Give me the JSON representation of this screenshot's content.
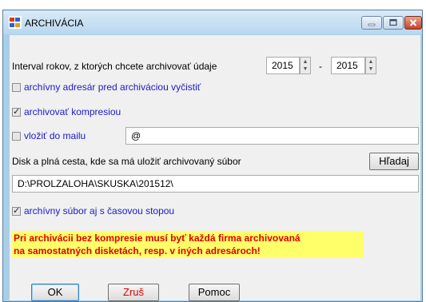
{
  "window": {
    "title": "ARCHIVÁCIA",
    "icons": [
      "app-icon",
      "minimize-icon",
      "maximize-icon",
      "close-icon"
    ]
  },
  "interval": {
    "label": "Interval rokov, z ktorých chcete archivovať údaje",
    "from": "2015",
    "separator": "-",
    "to": "2015"
  },
  "options": {
    "clear_dir": {
      "label": "archívny adresár pred archiváciou vyčistiť",
      "checked": false
    },
    "compress": {
      "label": "archivovať kompresiou",
      "checked": true
    },
    "mail": {
      "label": "vložiť do mailu",
      "checked": false,
      "value": "@"
    },
    "timestamp": {
      "label": "archívny súbor aj s časovou stopou",
      "checked": true
    }
  },
  "path": {
    "label": "Disk a plná cesta, kde sa má uložiť archivovaný súbor",
    "browse_label": "Hľadaj",
    "value": "D:\\PROLZALOHA\\SKUSKA\\201512\\"
  },
  "warning": {
    "line1": "Pri archivácii bez kompresie musí byť každá firma archivovaná",
    "line2": "na samostatných disketách, resp. v iných adresároch!"
  },
  "buttons": {
    "ok": "OK",
    "cancel": "Zruš",
    "help": "Pomoc"
  },
  "colors": {
    "frame": "#aad0e8",
    "client": "#f0f0f0",
    "option_text": "#1b1bcc",
    "warning_bg": "#ffff6a",
    "warning_text": "#e00000",
    "cancel_text": "#e00000"
  }
}
